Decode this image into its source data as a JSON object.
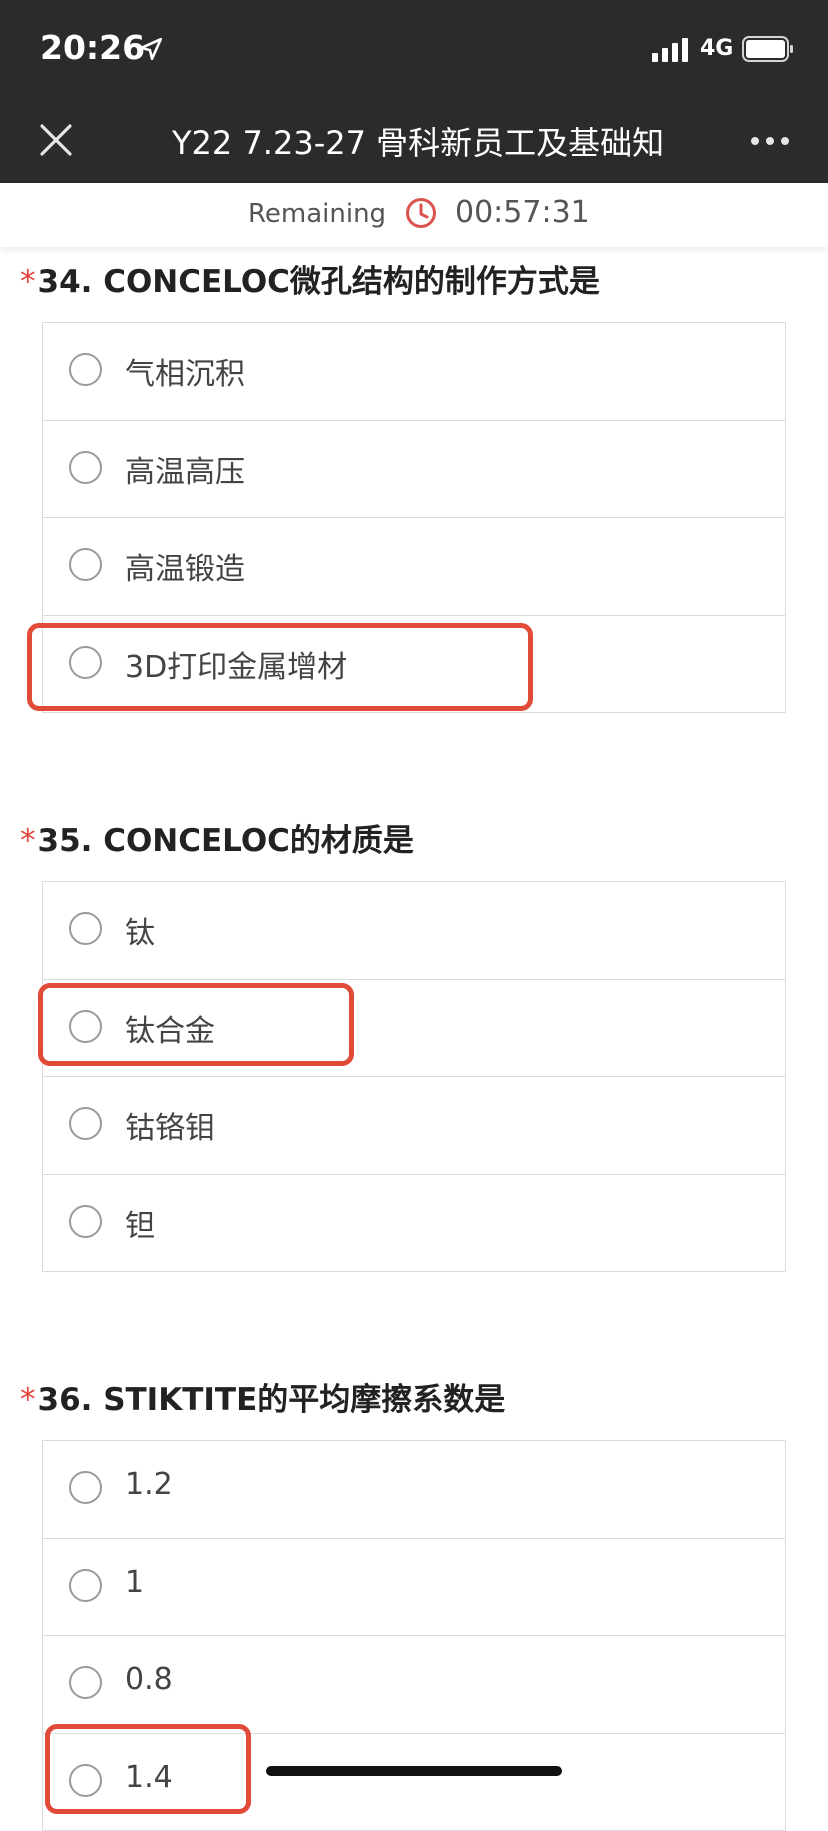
{
  "status_bar": {
    "time": "20:26",
    "network": "4G"
  },
  "nav": {
    "title": "Y22 7.23-27 骨科新员工及基础知"
  },
  "timer": {
    "label": "Remaining",
    "value": "00:57:31"
  },
  "colors": {
    "accent": "#e04a36",
    "star": "#e0443a",
    "topbar": "#2b2b2b"
  },
  "questions": [
    {
      "star": "*",
      "title": "34. CONCELOC微孔结构的制作方式是",
      "options": [
        "气相沉积",
        "高温高压",
        "高温锻造",
        "3D打印金属增材"
      ],
      "marked_option": "3D打印金属增材"
    },
    {
      "star": "*",
      "title": "35. CONCELOC的材质是",
      "options": [
        "钛",
        "钛合金",
        "钴铬钼",
        "钽"
      ],
      "marked_option": "钛合金"
    },
    {
      "star": "*",
      "title": "36. STIKTITE的平均摩擦系数是",
      "options": [
        "1.2",
        "1",
        "0.8",
        "1.4"
      ],
      "marked_option": "1.4"
    }
  ]
}
